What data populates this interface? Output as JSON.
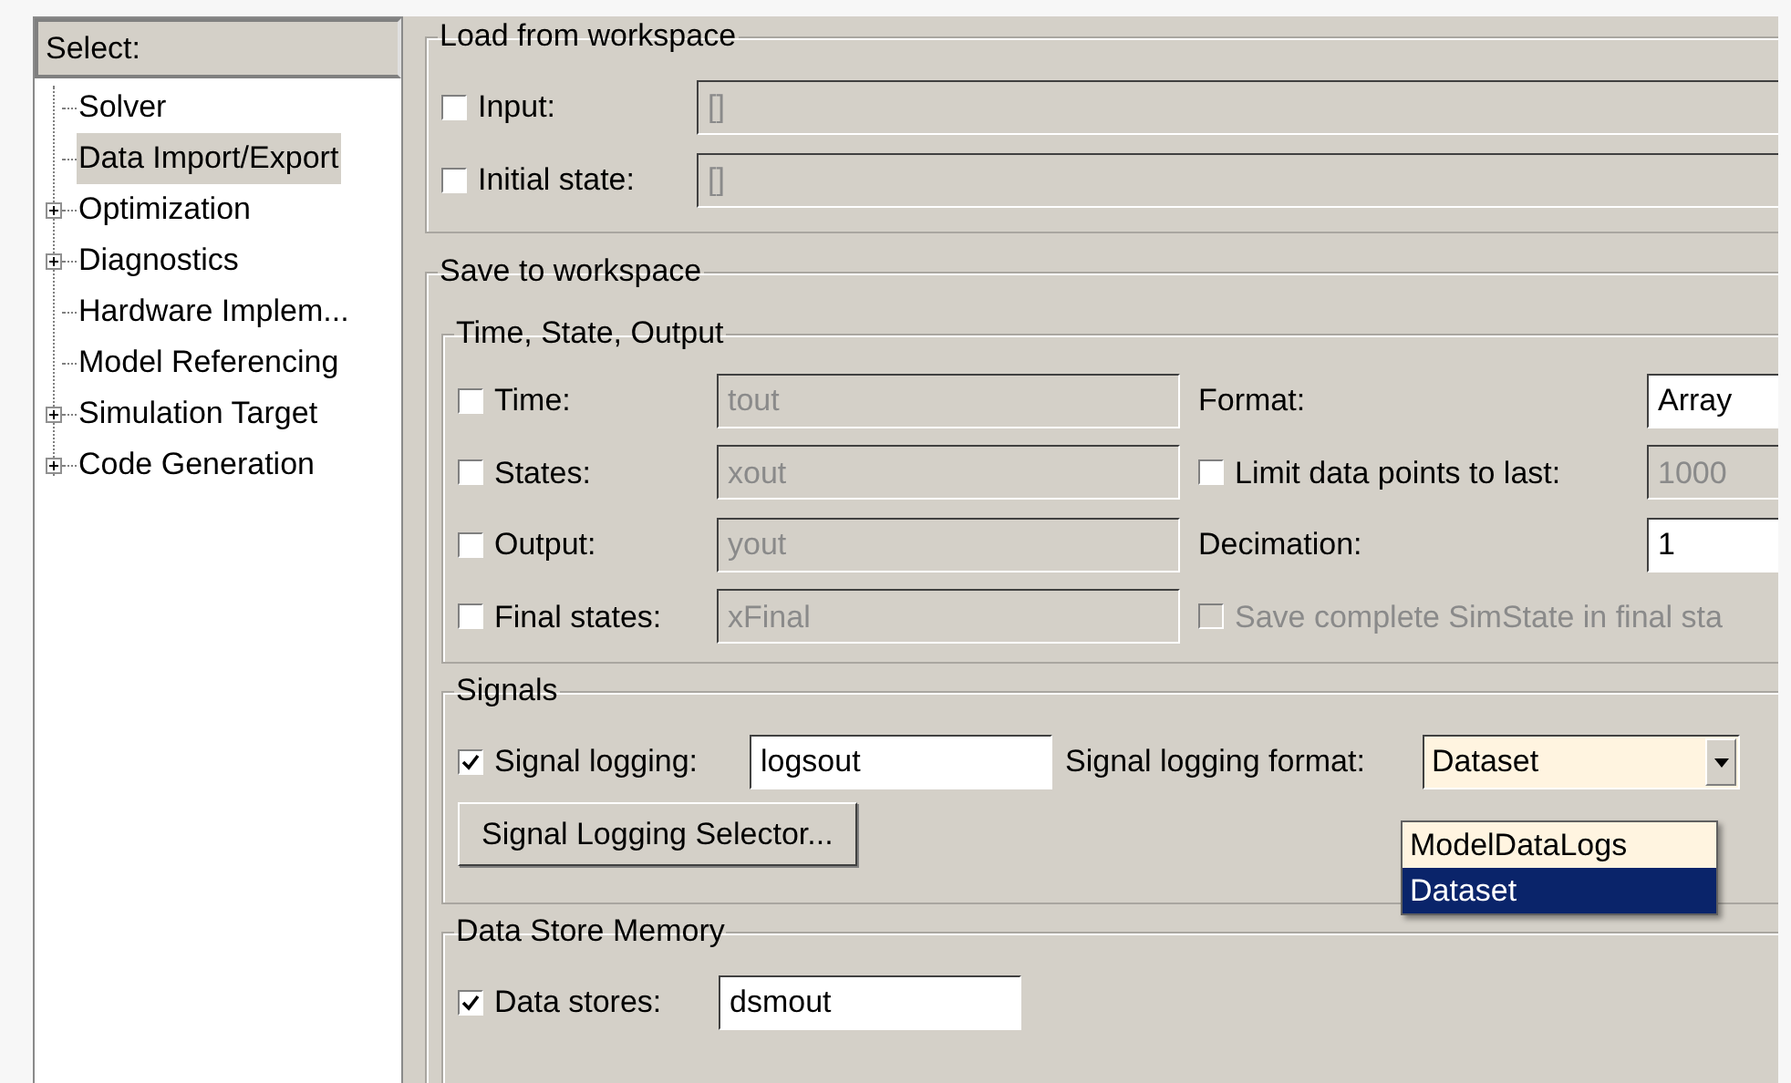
{
  "sidebar": {
    "title": "Select:",
    "items": [
      {
        "label": "Solver",
        "expandable": false,
        "selected": false
      },
      {
        "label": "Data Import/Export",
        "expandable": false,
        "selected": true
      },
      {
        "label": "Optimization",
        "expandable": true,
        "selected": false
      },
      {
        "label": "Diagnostics",
        "expandable": true,
        "selected": false
      },
      {
        "label": "Hardware Implem...",
        "expandable": false,
        "selected": false
      },
      {
        "label": "Model Referencing",
        "expandable": false,
        "selected": false
      },
      {
        "label": "Simulation Target",
        "expandable": true,
        "selected": false
      },
      {
        "label": "Code Generation",
        "expandable": true,
        "selected": false
      }
    ]
  },
  "load_from_workspace": {
    "title": "Load from workspace",
    "rows": [
      {
        "label": "Input:",
        "checked": false,
        "value": "[]",
        "disabled": true
      },
      {
        "label": "Initial state:",
        "checked": false,
        "value": "[]",
        "disabled": true
      }
    ]
  },
  "save_to_workspace": {
    "title": "Save to workspace",
    "time_state_output": {
      "title": "Time, State, Output",
      "rows": [
        {
          "label": "Time:",
          "checked": false,
          "value": "tout",
          "disabled": true
        },
        {
          "label": "States:",
          "checked": false,
          "value": "xout",
          "disabled": true
        },
        {
          "label": "Output:",
          "checked": false,
          "value": "yout",
          "disabled": true
        },
        {
          "label": "Final states:",
          "checked": false,
          "value": "xFinal",
          "disabled": true
        }
      ],
      "options": [
        {
          "kind": "field",
          "label": "Format:",
          "value": "Array",
          "disabled": false
        },
        {
          "kind": "checkfield",
          "label": "Limit data points to last:",
          "checked": false,
          "value": "1000",
          "disabled": true
        },
        {
          "kind": "field",
          "label": "Decimation:",
          "value": "1",
          "disabled": false
        },
        {
          "kind": "checkbox",
          "label": "Save complete SimState in final sta",
          "checked": false,
          "disabled": true
        }
      ]
    },
    "signals": {
      "title": "Signals",
      "signal_logging": {
        "label": "Signal logging:",
        "checked": true,
        "value": "logsout",
        "disabled": false
      },
      "format": {
        "label": "Signal logging format:",
        "value": "Dataset",
        "expanded": true,
        "options": [
          {
            "label": "ModelDataLogs",
            "selected": false
          },
          {
            "label": "Dataset",
            "selected": true
          }
        ]
      },
      "button": "Signal Logging Selector..."
    },
    "data_store_memory": {
      "title": "Data Store Memory",
      "data_stores": {
        "label": "Data stores:",
        "checked": true,
        "value": "dsmout",
        "disabled": false
      }
    }
  }
}
